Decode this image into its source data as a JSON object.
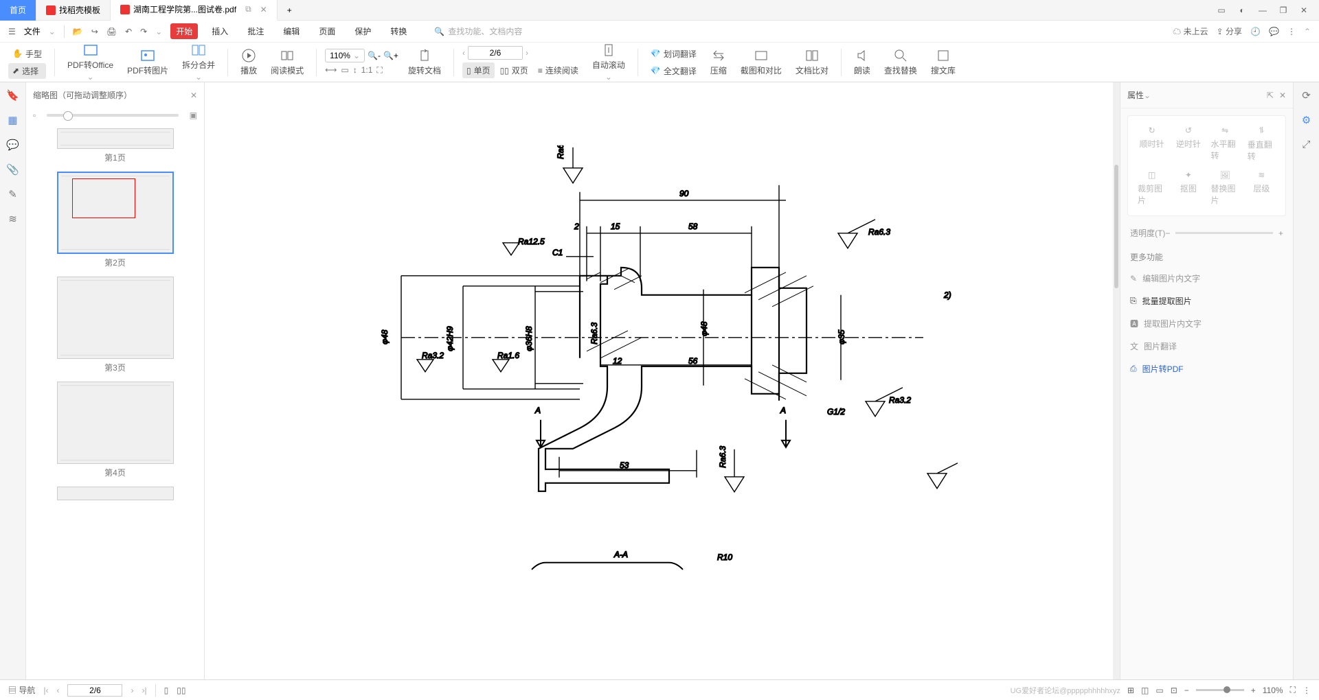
{
  "titlebar": {
    "tabs": [
      {
        "label": "首页",
        "type": "home"
      },
      {
        "label": "找稻壳模板",
        "icon": "docer"
      },
      {
        "label": "湖南工程学院第...图试卷.pdf",
        "icon": "pdf",
        "active": true
      }
    ],
    "new_tab": "+"
  },
  "menubar": {
    "file": "文件",
    "items": [
      "开始",
      "插入",
      "批注",
      "编辑",
      "页面",
      "保护",
      "转换"
    ],
    "active": "开始",
    "search_placeholder": "查找功能、文档内容",
    "cloud": "未上云",
    "share": "分享"
  },
  "tools": {
    "hand": "手型",
    "select": "选择"
  },
  "ribbon": {
    "pdf_office": "PDF转Office",
    "pdf_img": "PDF转图片",
    "split": "拆分合并",
    "play": "播放",
    "read": "阅读模式",
    "zoom": "110%",
    "rotate": "旋转文档",
    "single": "单页",
    "double": "双页",
    "cont": "连续阅读",
    "auto": "自动滚动",
    "word_tr": "划词翻译",
    "full_tr": "全文翻译",
    "compress": "压缩",
    "shot": "截图和对比",
    "compare": "文档比对",
    "tts": "朗读",
    "find": "查找替换",
    "lib": "搜文库",
    "page": "2/6"
  },
  "thumb": {
    "title": "缩略图（可拖动调整顺序）",
    "pages": [
      "第1页",
      "第2页",
      "第3页",
      "第4页"
    ]
  },
  "prop": {
    "title": "属性",
    "cw": "顺时针",
    "ccw": "逆时针",
    "fliph": "水平翻转",
    "flipv": "垂直翻转",
    "crop": "裁剪图片",
    "matting": "抠图",
    "replace": "替换图片",
    "layer": "层级",
    "opacity": "透明度(T)",
    "more": "更多功能",
    "edit_text": "编辑图片内文字",
    "batch": "批量提取图片",
    "extract": "提取图片内文字",
    "translate": "图片翻译",
    "to_pdf": "图片转PDF"
  },
  "drawing": {
    "dims": {
      "d1": "90",
      "d2": "2",
      "d3": "15",
      "d4": "58",
      "d5": "12",
      "d6": "56",
      "d7": "53",
      "dia1": "φ48",
      "dia2": "φ42H9",
      "dia3": "φ36H8",
      "dia4": "φ48",
      "dia5": "φ35",
      "ra1": "Ra6.3",
      "ra2": "Ra12.5",
      "ra3": "Ra6.3",
      "ra4": "Ra3.2",
      "ra5": "Ra1.6",
      "ra6": "Ra6.3",
      "ra7": "Ra3.2",
      "ra8": "Ra6.3",
      "c1": "C1",
      "g": "G1/2",
      "a1": "A",
      "a2": "A",
      "sec": "A-A",
      "r10": "R10",
      "ext": "2)"
    }
  },
  "status": {
    "nav": "导航",
    "page": "2/6",
    "zoom": "110%",
    "watermark": "UG爱好者论坛@ppppphhhhhxyz"
  }
}
